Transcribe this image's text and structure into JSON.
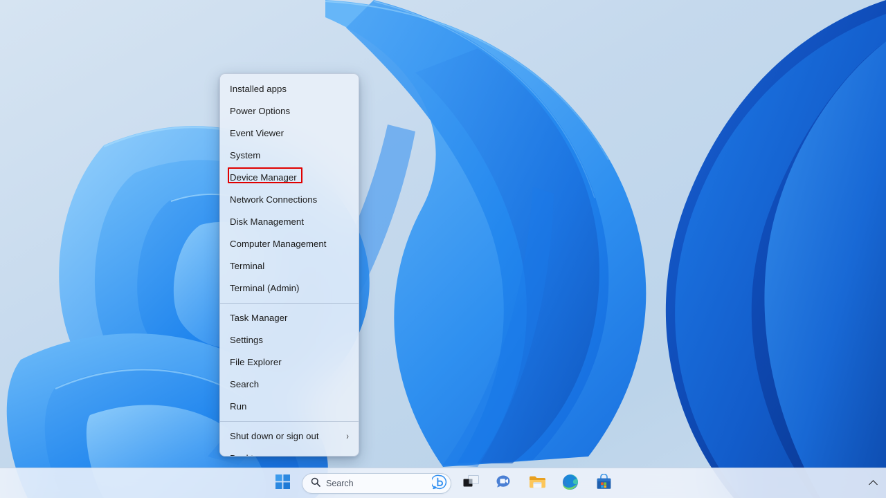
{
  "desktop": {
    "wallpaper_name": "bloom-wallpaper",
    "background_colors": [
      "#d2e2f0",
      "#c3d8ec",
      "#bcd4ea",
      "#c9dcee"
    ],
    "ribbon_colors": [
      "#2f8ef0",
      "#1a7ae8",
      "#1464d8",
      "#0f4fc0",
      "#0d3fa8",
      "#58b0f7",
      "#7fc4fa"
    ]
  },
  "winx_menu": {
    "name": "Win+X quick link menu",
    "groups": [
      {
        "items": [
          {
            "label": "Installed apps",
            "has_submenu": false,
            "highlighted": false
          },
          {
            "label": "Power Options",
            "has_submenu": false,
            "highlighted": false
          },
          {
            "label": "Event Viewer",
            "has_submenu": false,
            "highlighted": false
          },
          {
            "label": "System",
            "has_submenu": false,
            "highlighted": false
          },
          {
            "label": "Device Manager",
            "has_submenu": false,
            "highlighted": true
          },
          {
            "label": "Network Connections",
            "has_submenu": false,
            "highlighted": false
          },
          {
            "label": "Disk Management",
            "has_submenu": false,
            "highlighted": false
          },
          {
            "label": "Computer Management",
            "has_submenu": false,
            "highlighted": false
          },
          {
            "label": "Terminal",
            "has_submenu": false,
            "highlighted": false
          },
          {
            "label": "Terminal (Admin)",
            "has_submenu": false,
            "highlighted": false
          }
        ]
      },
      {
        "items": [
          {
            "label": "Task Manager",
            "has_submenu": false,
            "highlighted": false
          },
          {
            "label": "Settings",
            "has_submenu": false,
            "highlighted": false
          },
          {
            "label": "File Explorer",
            "has_submenu": false,
            "highlighted": false
          },
          {
            "label": "Search",
            "has_submenu": false,
            "highlighted": false
          },
          {
            "label": "Run",
            "has_submenu": false,
            "highlighted": false
          }
        ]
      },
      {
        "items": [
          {
            "label": "Shut down or sign out",
            "has_submenu": true,
            "submenu_glyph": "›",
            "highlighted": false
          },
          {
            "label": "Desktop",
            "has_submenu": false,
            "highlighted": false
          }
        ]
      }
    ],
    "highlight": {
      "target_label": "Device Manager",
      "color": "#e00000",
      "style": "rectangle-outline"
    }
  },
  "taskbar": {
    "start_button": {
      "icon": "windows-logo-icon",
      "label": "Start"
    },
    "search": {
      "icon": "search-icon",
      "placeholder": "Search",
      "value": "",
      "trailing_icon": "copilot-icon"
    },
    "buttons": [
      {
        "name": "task-view",
        "icon": "task-view-icon",
        "label": "Task view"
      },
      {
        "name": "chat",
        "icon": "chat-icon",
        "label": "Chat"
      },
      {
        "name": "file-explorer",
        "icon": "file-explorer-icon",
        "label": "File Explorer"
      },
      {
        "name": "microsoft-edge",
        "icon": "microsoft-edge-icon",
        "label": "Microsoft Edge"
      },
      {
        "name": "microsoft-store",
        "icon": "microsoft-store-icon",
        "label": "Microsoft Store"
      }
    ],
    "tray": {
      "show_hidden_icons": {
        "icon": "chevron-up-icon",
        "label": "Show hidden icons"
      }
    }
  }
}
